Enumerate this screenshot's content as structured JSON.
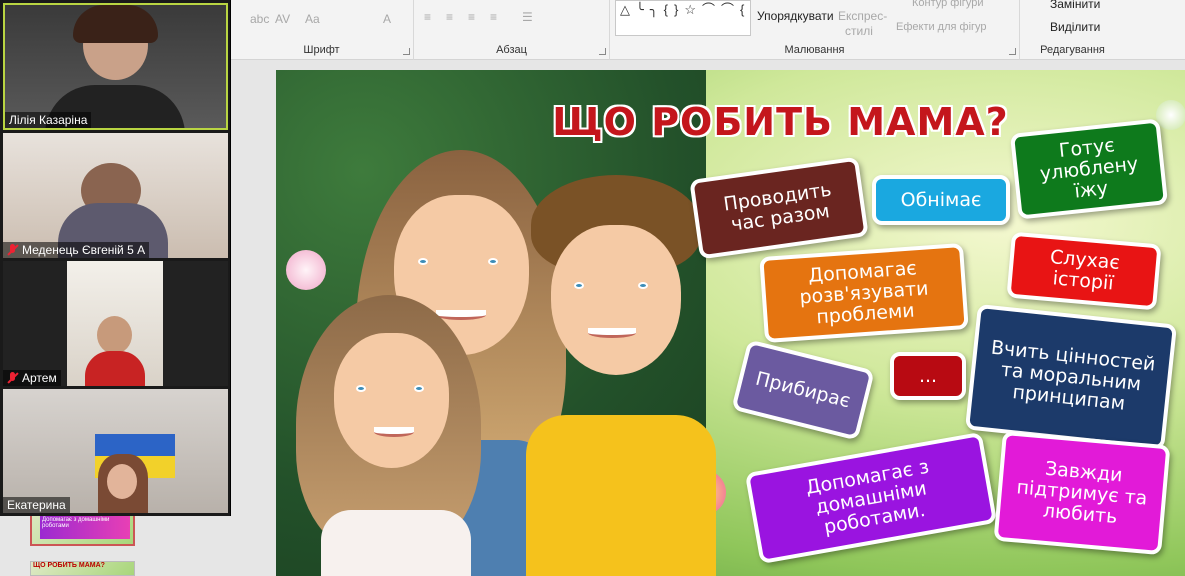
{
  "ribbon": {
    "groups": {
      "font": "Шрифт",
      "paragraph": "Абзац",
      "drawing": "Малювання",
      "editing": "Редагування"
    },
    "font_tools": [
      "abc",
      "AV",
      "Aa",
      "A"
    ],
    "paragraph_tools": [
      "≡",
      "≡",
      "≡",
      "≡",
      "☰"
    ],
    "shape_gallery": "△╰╮{}☆⌒⌒{}",
    "arrange_label": "Упорядкувати",
    "quick_styles_line1": "Експрес-",
    "quick_styles_line2": "стилі",
    "shape_outline": "Контур фігури",
    "shape_effects": "Ефекти для фігур",
    "replace": "Замінити",
    "select": "Виділити"
  },
  "participants": [
    {
      "name": "Лілія Казаріна",
      "muted": false,
      "active": true
    },
    {
      "name": "Меденець Євгеній 5 А",
      "muted": true,
      "active": false
    },
    {
      "name": "Артем",
      "muted": true,
      "active": false
    },
    {
      "name": "Екатерина",
      "muted": false,
      "active": false
    }
  ],
  "thumbnails": {
    "strip_text": "Допомагає з домашніми роботами",
    "second_title": "ЩО РОБИТЬ МАМА?"
  },
  "slide": {
    "title": "ЩО РОБИТЬ МАМА?",
    "cards": [
      {
        "text": "Проводить час разом",
        "color": "#6a2520"
      },
      {
        "text": "Обнімає",
        "color": "#1aa8e0"
      },
      {
        "text": "Готує улюблену їжу",
        "color": "#0e7a1c"
      },
      {
        "text": "Допомагає розв'язувати проблеми",
        "color": "#e57410"
      },
      {
        "text": "Слухає історії",
        "color": "#e81414"
      },
      {
        "text": "Прибирає",
        "color": "#6b5aa0"
      },
      {
        "text": "...",
        "color": "#b80a12"
      },
      {
        "text": "Вчить цінностей та моральним принципам",
        "color": "#1c3a6a"
      },
      {
        "text": "Допомагає з домашніми роботами.",
        "color": "#9a14e0"
      },
      {
        "text": "Завжди підтримує та любить",
        "color": "#e21ad8"
      }
    ]
  }
}
